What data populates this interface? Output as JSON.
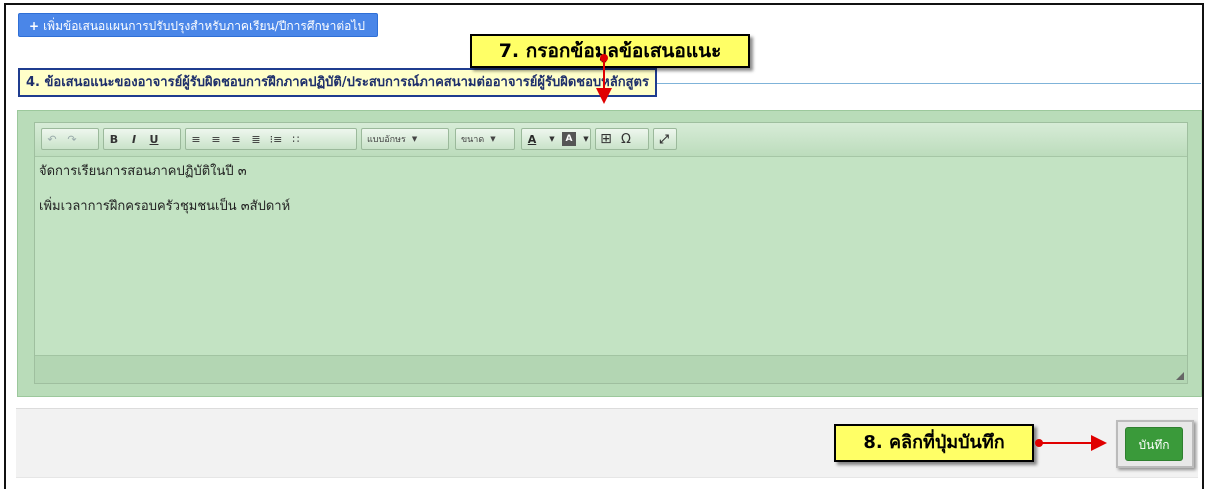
{
  "add_plan_button": {
    "icon": "+",
    "label": "เพิ่มข้อเสนอแผนการปรับปรุงสำหรับภาคเรียน/ปีการศึกษาต่อไป"
  },
  "section_title": "4. ข้อเสนอแนะของอาจารย์ผู้รับผิดชอบการฝึกภาคปฏิบัติ/ประสบการณ์ภาคสนามต่ออาจารย์ผู้รับผิดชอบหลักสูตร",
  "callouts": {
    "step7": "7. กรอกข้อมูลข้อเสนอแนะ",
    "step8": "8. คลิกที่ปุ่มบันทึก"
  },
  "toolbar": {
    "undo": "↶",
    "redo": "↷",
    "bold": "B",
    "italic": "I",
    "underline": "U",
    "font_family": "แบบอักษร",
    "font_size": "ขนาด",
    "font_color": "A",
    "bg_color": "A",
    "table": "⊞",
    "special_char": "Ω",
    "fullscreen": "⤢"
  },
  "editor": {
    "lines": [
      "จัดการเรียนการสอนภาคปฏิบัติในปี ๓",
      "เพิ่มเวลาการฝึกครอบครัวชุมชนเป็น ๓สัปดาห์"
    ]
  },
  "save_button": {
    "label": "บันทึก"
  },
  "colors": {
    "accent": "#4a86e8",
    "editor_bg": "#c3e3c3",
    "callout": "#ffff66",
    "arrow": "#e00000",
    "save": "#3a9a3a"
  }
}
